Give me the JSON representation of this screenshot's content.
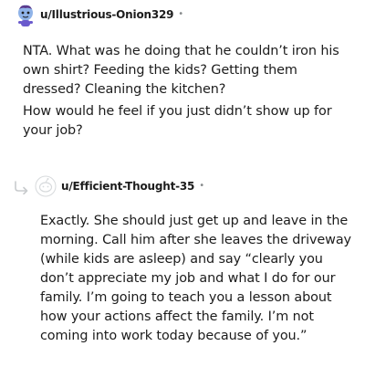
{
  "comments": [
    {
      "username": "u/Illustrious-Onion329",
      "separator": "•",
      "avatar": "snoo-avatar-icon",
      "paragraphs": [
        "NTA. What was he doing that he couldn’t iron his own shirt? Feeding the kids? Getting them dressed? Cleaning the kitchen?",
        "How would he feel if you just didn’t show up for your job?"
      ]
    },
    {
      "username": "u/Efficient-Thought-35",
      "separator": "•",
      "avatar": "default-avatar-icon",
      "reply_icon": "reply-arrow-icon",
      "paragraphs": [
        "Exactly. She should just get up and leave in the morning. Call him after she leaves the driveway (while kids are asleep) and say “clearly you don’t appreciate my job and what I do for our family. I’m going to teach you a lesson about how your actions affect the family. I’m not coming into work today because of you.”"
      ]
    }
  ],
  "colors": {
    "text": "#1c1c1c",
    "meta": "#878a8c",
    "icon_gray": "#c8cbcd"
  }
}
